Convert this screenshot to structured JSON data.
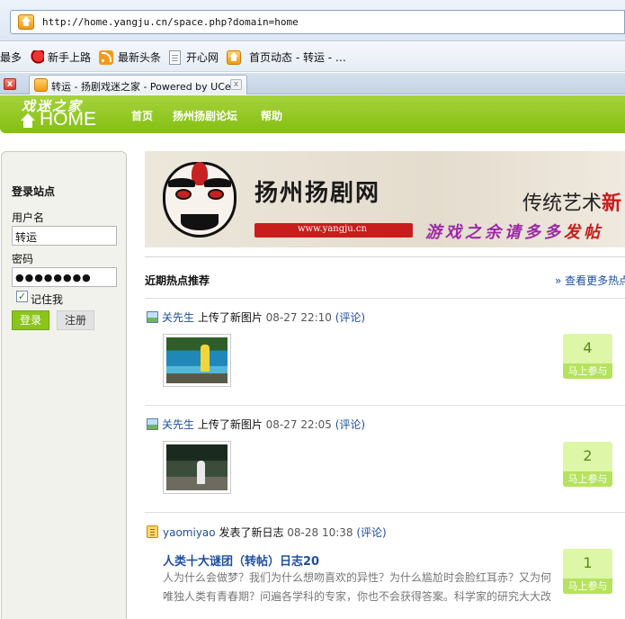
{
  "browser": {
    "url": "http://home.yangju.cn/space.php?domain=home",
    "bookmarks": [
      "最多",
      "新手上路",
      "最新头条",
      "开心网",
      "首页动态 - 转运 - …"
    ],
    "tab_title": "转运 - 扬剧戏迷之家 - Powered by UCenter Home",
    "tab_close": "x"
  },
  "site": {
    "logo_cn": "戏迷之家",
    "logo_en": "HOME",
    "nav": [
      "首页",
      "扬州扬剧论坛",
      "帮助"
    ]
  },
  "login": {
    "title": "登录站点",
    "username_label": "用户名",
    "username_value": "转运",
    "password_label": "密码",
    "password_value": "●●●●●●●●",
    "remember_label": "记住我",
    "remember_checked": "✓",
    "login_button": "登录",
    "register_button": "注册"
  },
  "banner": {
    "title": "扬州扬剧网",
    "url": "www.yangju.cn",
    "art_text": "传统艺术",
    "art_text_tail": "新",
    "slogan": "游戏之余请多多",
    "slogan_tail": "发帖"
  },
  "feed": {
    "title": "近期热点推荐",
    "more": "» 查看更多热点",
    "join_label": "马上参与",
    "items": [
      {
        "user": "关先生",
        "action": " 上传了新图片 ",
        "time": "08-27 22:10",
        "comment": "(评论)",
        "count": "4"
      },
      {
        "user": "关先生",
        "action": " 上传了新图片 ",
        "time": "08-27 22:05",
        "comment": "(评论)",
        "count": "2"
      },
      {
        "user": "yaomiyao",
        "action": " 发表了新日志 ",
        "time": "08-28 10:38",
        "comment": "(评论)",
        "count": "1",
        "blog_title": "人类十大谜团（转帖）日志20",
        "blog_excerpt": "人为什么会做梦？我们为什么想吻喜欢的异性？为什么尴尬时会脸红耳赤？又为何唯独人类有青春期？问遍各学科的专家，你也不会获得答案。科学家的研究大大改"
      }
    ]
  }
}
